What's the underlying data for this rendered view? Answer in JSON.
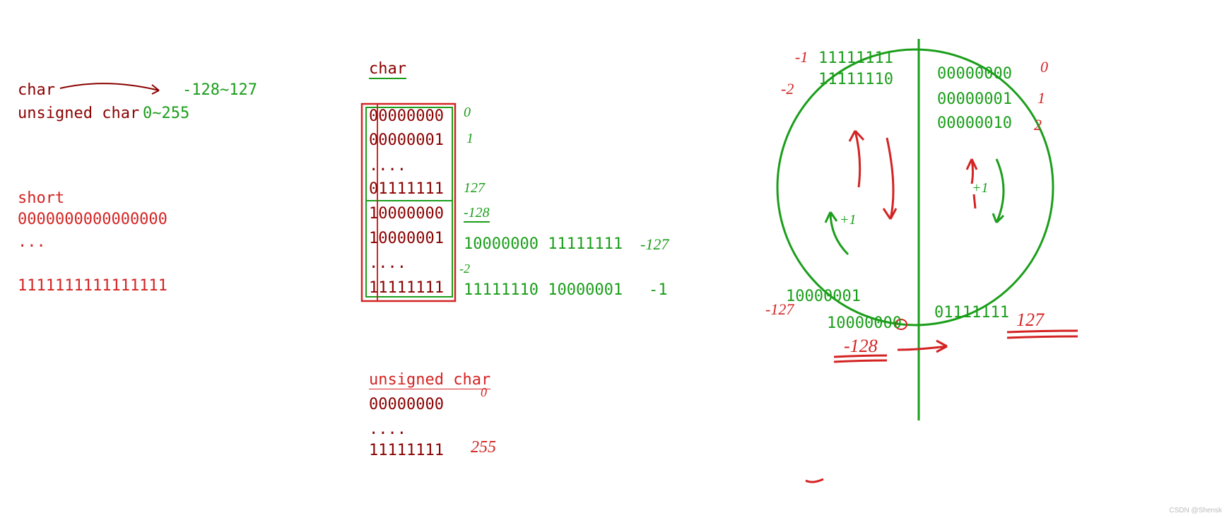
{
  "left_panel": {
    "char_label": "char",
    "char_range": "-128~127",
    "uchar_label": "unsigned char",
    "uchar_range": "0~255",
    "short_label": "short",
    "short_zero": "0000000000000000",
    "short_dots": "...",
    "short_max": "1111111111111111"
  },
  "mid_panel": {
    "char_title": "char",
    "rows": {
      "r0": "00000000",
      "r1": "00000001",
      "rdots1": "....",
      "r127": "01111111",
      "r128": "10000000",
      "r129": "10000001",
      "rdots2": "....",
      "r255": "11111111"
    },
    "ann": {
      "a0": "0",
      "a1": "1",
      "a127": "127",
      "a_neg128": "-128",
      "a_neg127": "10000000 11111111",
      "a_neg127_val": "-127",
      "a_neg2": "-2",
      "a_neg1_bits": "11111110 10000001",
      "a_neg1": "-1"
    },
    "uchar_title": "unsigned char",
    "uchar": {
      "u0": "00000000",
      "u0_ann": "0",
      "udots": "....",
      "u255": "11111111",
      "u255_ann": "255"
    }
  },
  "circle": {
    "top_left1": "11111111",
    "top_left2": "11111110",
    "top_right1": "00000000",
    "top_right2": "00000001",
    "top_right3": "00000010",
    "bot_left1": "10000001",
    "bot_left2": "10000000",
    "bot_right1": "01111111",
    "ann": {
      "neg1": "-1",
      "neg2": "-2",
      "zero": "0",
      "one": "1",
      "two": "2",
      "neg127": "-127",
      "neg128": "-128",
      "pos127": "127",
      "plus1a": "+1",
      "plus1b": "+1"
    }
  },
  "watermark": "CSDN @Shensk"
}
